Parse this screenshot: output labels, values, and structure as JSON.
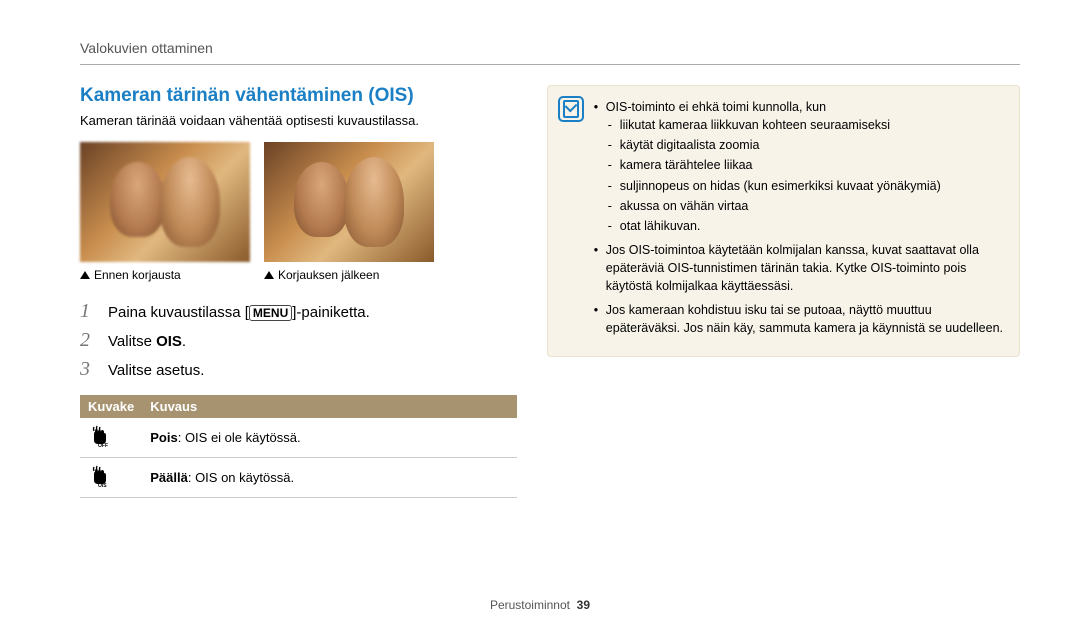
{
  "header": "Valokuvien ottaminen",
  "section_title": "Kameran tärinän vähentäminen (OIS)",
  "intro": "Kameran tärinää voidaan vähentää optisesti kuvaustilassa.",
  "captions": {
    "before": "Ennen korjausta",
    "after": "Korjauksen jälkeen"
  },
  "steps": {
    "s1_a": "Paina kuvaustilassa [",
    "s1_menu": "MENU",
    "s1_b": "]-painiketta.",
    "s2_a": "Valitse ",
    "s2_b": "OIS",
    "s2_c": ".",
    "s3": "Valitse asetus."
  },
  "table": {
    "h1": "Kuvake",
    "h2": "Kuvaus",
    "r1_b": "Pois",
    "r1_t": ": OIS ei ole käytössä.",
    "r2_b": "Päällä",
    "r2_t": ": OIS on käytössä."
  },
  "note": {
    "b1": "OIS-toiminto ei ehkä toimi kunnolla, kun",
    "s1": "liikutat kameraa liikkuvan kohteen seuraamiseksi",
    "s2": "käytät digitaalista zoomia",
    "s3": "kamera tärähtelee liikaa",
    "s4": "suljinnopeus on hidas (kun esimerkiksi kuvaat yönäkymiä)",
    "s5": "akussa on vähän virtaa",
    "s6": "otat lähikuvan.",
    "b2": "Jos OIS-toimintoa käytetään kolmijalan kanssa, kuvat saattavat olla epäteräviä OIS-tunnistimen tärinän takia. Kytke OIS-toiminto pois käytöstä kolmijalkaa käyttäessäsi.",
    "b3": "Jos kameraan kohdistuu isku tai se putoaa, näyttö muuttuu epäteräväksi. Jos näin käy, sammuta kamera ja käynnistä se uudelleen."
  },
  "footer": {
    "section": "Perustoiminnot",
    "page": "39"
  }
}
